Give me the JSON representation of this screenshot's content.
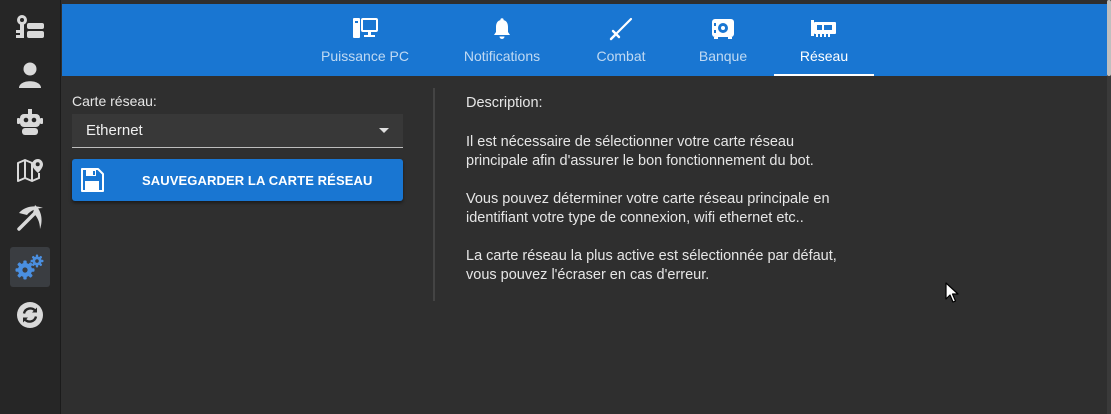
{
  "sidebar": {
    "items": [
      {
        "name": "keys",
        "icon": "keys-icon",
        "active": false
      },
      {
        "name": "user",
        "icon": "user-icon",
        "active": false
      },
      {
        "name": "bot",
        "icon": "robot-icon",
        "active": false
      },
      {
        "name": "map",
        "icon": "map-icon",
        "active": false
      },
      {
        "name": "pickaxe",
        "icon": "pickaxe-icon",
        "active": false
      },
      {
        "name": "settings",
        "icon": "gears-icon",
        "active": true
      },
      {
        "name": "sync",
        "icon": "sync-icon",
        "active": false
      }
    ]
  },
  "tabs": [
    {
      "label": "Puissance PC",
      "icon": "pc-icon",
      "active": false
    },
    {
      "label": "Notifications",
      "icon": "bell-icon",
      "active": false
    },
    {
      "label": "Combat",
      "icon": "sword-icon",
      "active": false
    },
    {
      "label": "Banque",
      "icon": "safe-icon",
      "active": false
    },
    {
      "label": "Réseau",
      "icon": "network-card-icon",
      "active": true
    }
  ],
  "form": {
    "label": "Carte réseau:",
    "selected": "Ethernet",
    "save_label": "SAUVEGARDER LA CARTE RÉSEAU"
  },
  "description": {
    "title": "Description:",
    "p1": "Il est nécessaire de sélectionner votre carte réseau\nprincipale afin d'assurer le bon fonctionnement du bot.",
    "p2": "Vous pouvez déterminer votre carte réseau principale en\nidentifiant votre type de connexion, wifi ethernet etc..",
    "p3": "La carte réseau la plus active est sélectionnée par défaut,\nvous pouvez l'écraser en cas d'erreur."
  },
  "colors": {
    "accent": "#1976d2",
    "background": "#2f2f2f",
    "sidebar": "#262626",
    "icon": "#d9d9d9",
    "active_icon": "#4a8fe0"
  }
}
